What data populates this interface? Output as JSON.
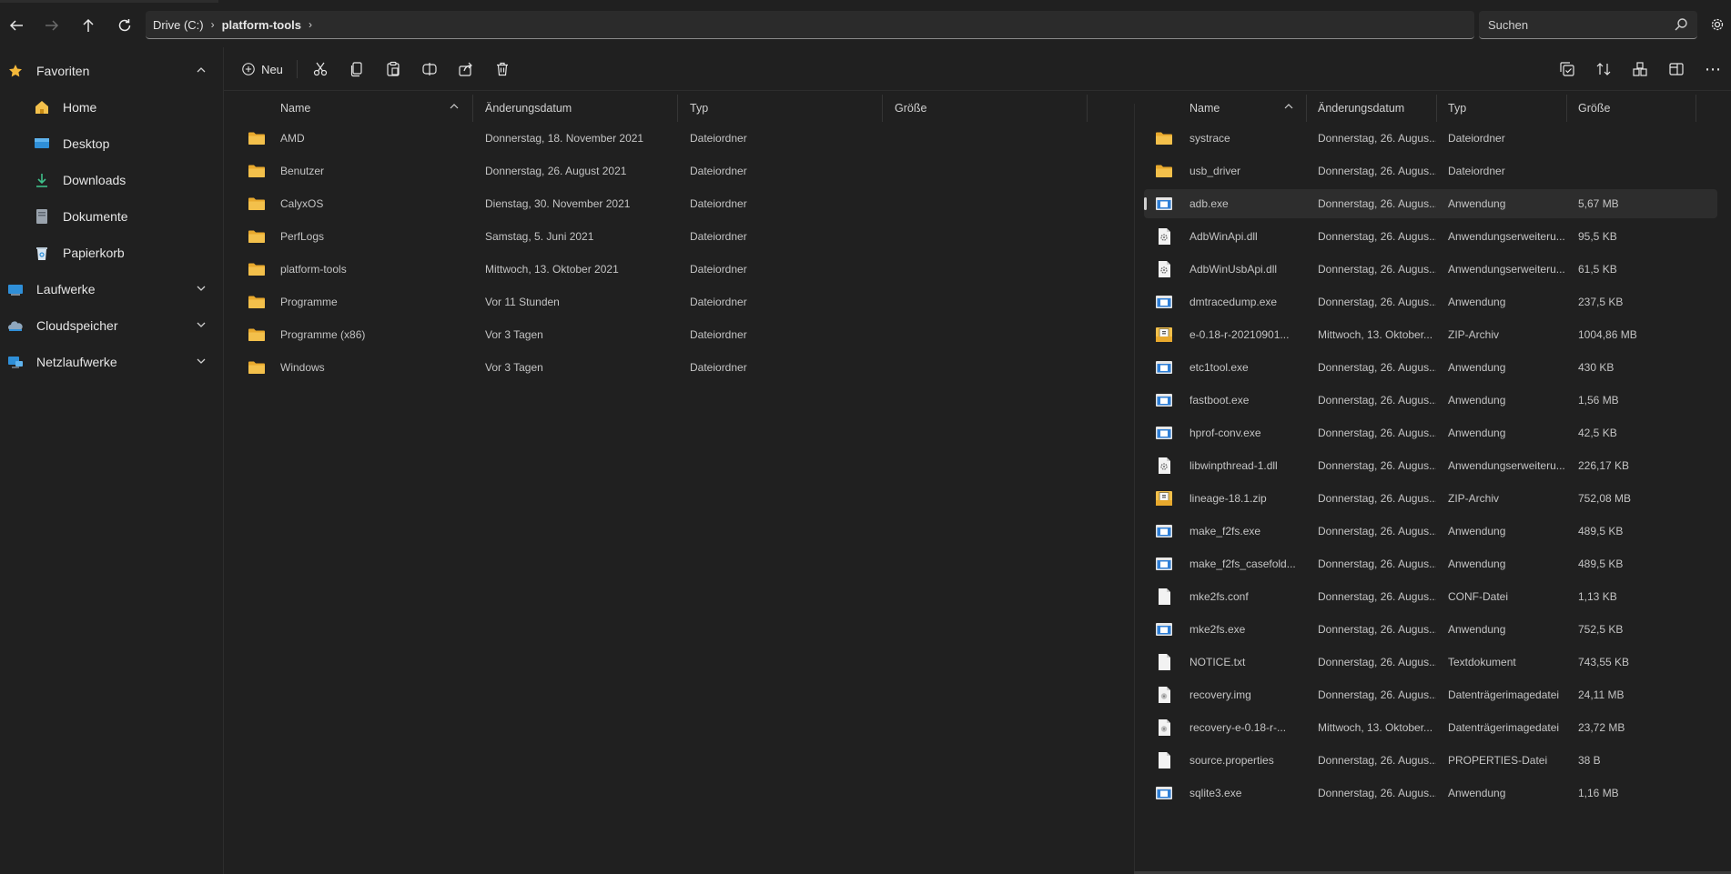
{
  "address": {
    "crumbs": [
      "Drive (C:)",
      "platform-tools"
    ]
  },
  "search": {
    "placeholder": "Suchen"
  },
  "sidebar": {
    "favorites_label": "Favoriten",
    "items": [
      {
        "label": "Home",
        "icon": "home-icon"
      },
      {
        "label": "Desktop",
        "icon": "desktop-icon"
      },
      {
        "label": "Downloads",
        "icon": "download-icon"
      },
      {
        "label": "Dokumente",
        "icon": "document-icon"
      },
      {
        "label": "Papierkorb",
        "icon": "recycle-bin-icon"
      }
    ],
    "sections": [
      {
        "label": "Laufwerke",
        "icon": "drive-icon"
      },
      {
        "label": "Cloudspeicher",
        "icon": "cloud-icon"
      },
      {
        "label": "Netzlaufwerke",
        "icon": "network-icon"
      }
    ]
  },
  "toolbar": {
    "new_label": "Neu"
  },
  "left_pane": {
    "columns": [
      "Name",
      "Änderungsdatum",
      "Typ",
      "Größe"
    ],
    "rows": [
      {
        "name": "AMD",
        "date": "Donnerstag, 18. November 2021",
        "type": "Dateiordner"
      },
      {
        "name": "Benutzer",
        "date": "Donnerstag, 26. August 2021",
        "type": "Dateiordner"
      },
      {
        "name": "CalyxOS",
        "date": "Dienstag, 30. November 2021",
        "type": "Dateiordner"
      },
      {
        "name": "PerfLogs",
        "date": "Samstag, 5. Juni 2021",
        "type": "Dateiordner"
      },
      {
        "name": "platform-tools",
        "date": "Mittwoch, 13. Oktober 2021",
        "type": "Dateiordner"
      },
      {
        "name": "Programme",
        "date": "Vor 11 Stunden",
        "type": "Dateiordner"
      },
      {
        "name": "Programme (x86)",
        "date": "Vor 3 Tagen",
        "type": "Dateiordner"
      },
      {
        "name": "Windows",
        "date": "Vor 3 Tagen",
        "type": "Dateiordner"
      }
    ]
  },
  "right_pane": {
    "columns": [
      "Name",
      "Änderungsdatum",
      "Typ",
      "Größe"
    ],
    "rows": [
      {
        "name": "systrace",
        "date": "Donnerstag, 26. Augus...",
        "type": "Dateiordner",
        "size": "",
        "icon": "folder"
      },
      {
        "name": "usb_driver",
        "date": "Donnerstag, 26. Augus...",
        "type": "Dateiordner",
        "size": "",
        "icon": "folder"
      },
      {
        "name": "adb.exe",
        "date": "Donnerstag, 26. Augus...",
        "type": "Anwendung",
        "size": "5,67 MB",
        "icon": "exe"
      },
      {
        "name": "AdbWinApi.dll",
        "date": "Donnerstag, 26. Augus...",
        "type": "Anwendungserweiteru...",
        "size": "95,5 KB",
        "icon": "dll"
      },
      {
        "name": "AdbWinUsbApi.dll",
        "date": "Donnerstag, 26. Augus...",
        "type": "Anwendungserweiteru...",
        "size": "61,5 KB",
        "icon": "dll"
      },
      {
        "name": "dmtracedump.exe",
        "date": "Donnerstag, 26. Augus...",
        "type": "Anwendung",
        "size": "237,5 KB",
        "icon": "exe"
      },
      {
        "name": "e-0.18-r-20210901...",
        "date": "Mittwoch, 13. Oktober...",
        "type": "ZIP-Archiv",
        "size": "1004,86 MB",
        "icon": "zip"
      },
      {
        "name": "etc1tool.exe",
        "date": "Donnerstag, 26. Augus...",
        "type": "Anwendung",
        "size": "430 KB",
        "icon": "exe"
      },
      {
        "name": "fastboot.exe",
        "date": "Donnerstag, 26. Augus...",
        "type": "Anwendung",
        "size": "1,56 MB",
        "icon": "exe"
      },
      {
        "name": "hprof-conv.exe",
        "date": "Donnerstag, 26. Augus...",
        "type": "Anwendung",
        "size": "42,5 KB",
        "icon": "exe"
      },
      {
        "name": "libwinpthread-1.dll",
        "date": "Donnerstag, 26. Augus...",
        "type": "Anwendungserweiteru...",
        "size": "226,17 KB",
        "icon": "dll"
      },
      {
        "name": "lineage-18.1.zip",
        "date": "Donnerstag, 26. Augus...",
        "type": "ZIP-Archiv",
        "size": "752,08 MB",
        "icon": "zip"
      },
      {
        "name": "make_f2fs.exe",
        "date": "Donnerstag, 26. Augus...",
        "type": "Anwendung",
        "size": "489,5 KB",
        "icon": "exe"
      },
      {
        "name": "make_f2fs_casefold...",
        "date": "Donnerstag, 26. Augus...",
        "type": "Anwendung",
        "size": "489,5 KB",
        "icon": "exe"
      },
      {
        "name": "mke2fs.conf",
        "date": "Donnerstag, 26. Augus...",
        "type": "CONF-Datei",
        "size": "1,13 KB",
        "icon": "file"
      },
      {
        "name": "mke2fs.exe",
        "date": "Donnerstag, 26. Augus...",
        "type": "Anwendung",
        "size": "752,5 KB",
        "icon": "exe"
      },
      {
        "name": "NOTICE.txt",
        "date": "Donnerstag, 26. Augus...",
        "type": "Textdokument",
        "size": "743,55 KB",
        "icon": "file"
      },
      {
        "name": "recovery.img",
        "date": "Donnerstag, 26. Augus...",
        "type": "Datenträgerimagedatei",
        "size": "24,11 MB",
        "icon": "img"
      },
      {
        "name": "recovery-e-0.18-r-...",
        "date": "Mittwoch, 13. Oktober...",
        "type": "Datenträgerimagedatei",
        "size": "23,72 MB",
        "icon": "img"
      },
      {
        "name": "source.properties",
        "date": "Donnerstag, 26. Augus...",
        "type": "PROPERTIES-Datei",
        "size": "38 B",
        "icon": "file"
      },
      {
        "name": "sqlite3.exe",
        "date": "Donnerstag, 26. Augus...",
        "type": "Anwendung",
        "size": "1,16 MB",
        "icon": "exe"
      }
    ]
  },
  "colors": {
    "background": "#202020",
    "folder": "#f3c04b",
    "exe_blue": "#2f7fd6",
    "accent_star": "#f4b83a"
  }
}
